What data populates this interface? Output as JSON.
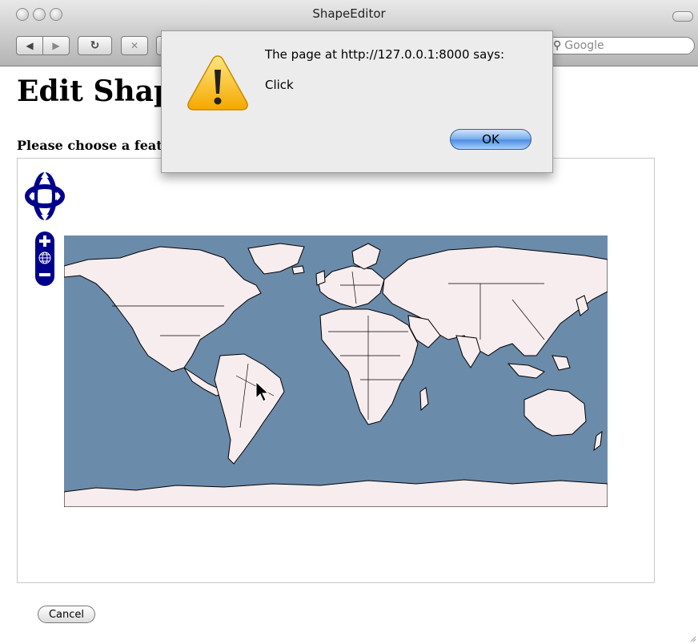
{
  "window": {
    "title": "ShapeEditor"
  },
  "toolbar": {
    "back_icon": "back-arrow-icon",
    "forward_icon": "forward-arrow-icon",
    "reload_icon": "reload-icon",
    "stop_icon": "stop-icon",
    "search_placeholder": "Google"
  },
  "page": {
    "title": "Edit Shap",
    "prompt": "Please choose a featu",
    "cancel_label": "Cancel"
  },
  "map": {
    "ocean_color": "#6b8bab",
    "land_color": "#f7edee",
    "pan_control_icon": "pan-arrows-icon",
    "zoom_in_icon": "zoom-in-icon",
    "zoom_world_icon": "globe-icon",
    "zoom_out_icon": "zoom-out-icon"
  },
  "alert": {
    "message": "The page at http://127.0.0.1:8000 says:",
    "body": "Click",
    "ok_label": "OK",
    "icon": "warning-icon"
  }
}
